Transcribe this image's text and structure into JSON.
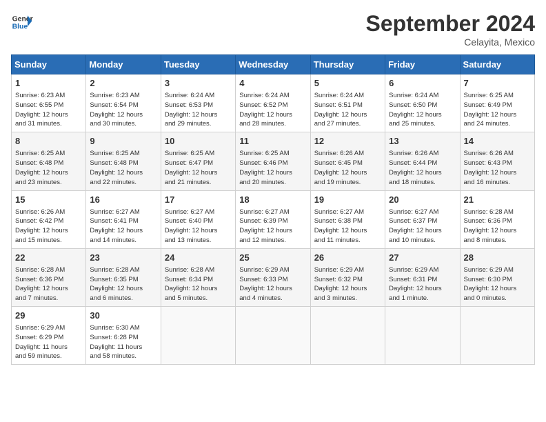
{
  "logo": {
    "line1": "General",
    "line2": "Blue"
  },
  "title": "September 2024",
  "subtitle": "Celayita, Mexico",
  "days_of_week": [
    "Sunday",
    "Monday",
    "Tuesday",
    "Wednesday",
    "Thursday",
    "Friday",
    "Saturday"
  ],
  "weeks": [
    [
      {
        "day": "1",
        "info": "Sunrise: 6:23 AM\nSunset: 6:55 PM\nDaylight: 12 hours\nand 31 minutes."
      },
      {
        "day": "2",
        "info": "Sunrise: 6:23 AM\nSunset: 6:54 PM\nDaylight: 12 hours\nand 30 minutes."
      },
      {
        "day": "3",
        "info": "Sunrise: 6:24 AM\nSunset: 6:53 PM\nDaylight: 12 hours\nand 29 minutes."
      },
      {
        "day": "4",
        "info": "Sunrise: 6:24 AM\nSunset: 6:52 PM\nDaylight: 12 hours\nand 28 minutes."
      },
      {
        "day": "5",
        "info": "Sunrise: 6:24 AM\nSunset: 6:51 PM\nDaylight: 12 hours\nand 27 minutes."
      },
      {
        "day": "6",
        "info": "Sunrise: 6:24 AM\nSunset: 6:50 PM\nDaylight: 12 hours\nand 25 minutes."
      },
      {
        "day": "7",
        "info": "Sunrise: 6:25 AM\nSunset: 6:49 PM\nDaylight: 12 hours\nand 24 minutes."
      }
    ],
    [
      {
        "day": "8",
        "info": "Sunrise: 6:25 AM\nSunset: 6:48 PM\nDaylight: 12 hours\nand 23 minutes."
      },
      {
        "day": "9",
        "info": "Sunrise: 6:25 AM\nSunset: 6:48 PM\nDaylight: 12 hours\nand 22 minutes."
      },
      {
        "day": "10",
        "info": "Sunrise: 6:25 AM\nSunset: 6:47 PM\nDaylight: 12 hours\nand 21 minutes."
      },
      {
        "day": "11",
        "info": "Sunrise: 6:25 AM\nSunset: 6:46 PM\nDaylight: 12 hours\nand 20 minutes."
      },
      {
        "day": "12",
        "info": "Sunrise: 6:26 AM\nSunset: 6:45 PM\nDaylight: 12 hours\nand 19 minutes."
      },
      {
        "day": "13",
        "info": "Sunrise: 6:26 AM\nSunset: 6:44 PM\nDaylight: 12 hours\nand 18 minutes."
      },
      {
        "day": "14",
        "info": "Sunrise: 6:26 AM\nSunset: 6:43 PM\nDaylight: 12 hours\nand 16 minutes."
      }
    ],
    [
      {
        "day": "15",
        "info": "Sunrise: 6:26 AM\nSunset: 6:42 PM\nDaylight: 12 hours\nand 15 minutes."
      },
      {
        "day": "16",
        "info": "Sunrise: 6:27 AM\nSunset: 6:41 PM\nDaylight: 12 hours\nand 14 minutes."
      },
      {
        "day": "17",
        "info": "Sunrise: 6:27 AM\nSunset: 6:40 PM\nDaylight: 12 hours\nand 13 minutes."
      },
      {
        "day": "18",
        "info": "Sunrise: 6:27 AM\nSunset: 6:39 PM\nDaylight: 12 hours\nand 12 minutes."
      },
      {
        "day": "19",
        "info": "Sunrise: 6:27 AM\nSunset: 6:38 PM\nDaylight: 12 hours\nand 11 minutes."
      },
      {
        "day": "20",
        "info": "Sunrise: 6:27 AM\nSunset: 6:37 PM\nDaylight: 12 hours\nand 10 minutes."
      },
      {
        "day": "21",
        "info": "Sunrise: 6:28 AM\nSunset: 6:36 PM\nDaylight: 12 hours\nand 8 minutes."
      }
    ],
    [
      {
        "day": "22",
        "info": "Sunrise: 6:28 AM\nSunset: 6:36 PM\nDaylight: 12 hours\nand 7 minutes."
      },
      {
        "day": "23",
        "info": "Sunrise: 6:28 AM\nSunset: 6:35 PM\nDaylight: 12 hours\nand 6 minutes."
      },
      {
        "day": "24",
        "info": "Sunrise: 6:28 AM\nSunset: 6:34 PM\nDaylight: 12 hours\nand 5 minutes."
      },
      {
        "day": "25",
        "info": "Sunrise: 6:29 AM\nSunset: 6:33 PM\nDaylight: 12 hours\nand 4 minutes."
      },
      {
        "day": "26",
        "info": "Sunrise: 6:29 AM\nSunset: 6:32 PM\nDaylight: 12 hours\nand 3 minutes."
      },
      {
        "day": "27",
        "info": "Sunrise: 6:29 AM\nSunset: 6:31 PM\nDaylight: 12 hours\nand 1 minute."
      },
      {
        "day": "28",
        "info": "Sunrise: 6:29 AM\nSunset: 6:30 PM\nDaylight: 12 hours\nand 0 minutes."
      }
    ],
    [
      {
        "day": "29",
        "info": "Sunrise: 6:29 AM\nSunset: 6:29 PM\nDaylight: 11 hours\nand 59 minutes."
      },
      {
        "day": "30",
        "info": "Sunrise: 6:30 AM\nSunset: 6:28 PM\nDaylight: 11 hours\nand 58 minutes."
      },
      {
        "day": "",
        "info": ""
      },
      {
        "day": "",
        "info": ""
      },
      {
        "day": "",
        "info": ""
      },
      {
        "day": "",
        "info": ""
      },
      {
        "day": "",
        "info": ""
      }
    ]
  ]
}
